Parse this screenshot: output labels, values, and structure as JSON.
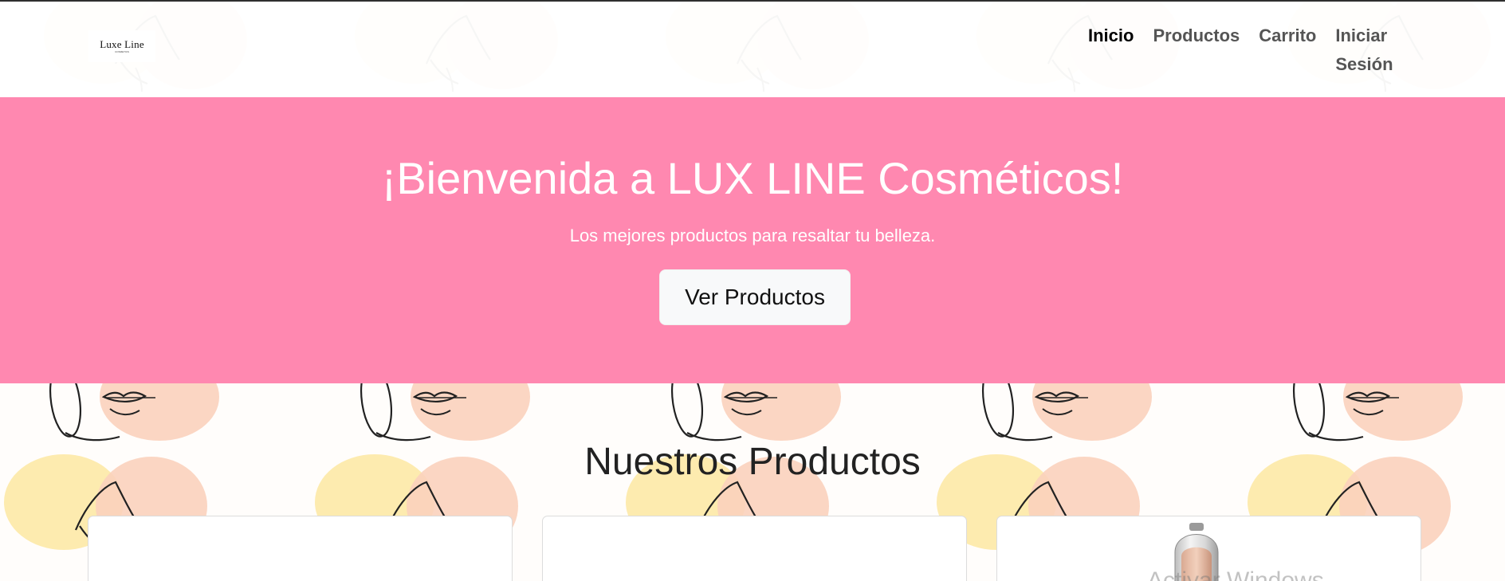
{
  "brand": {
    "name": "Luxe Line",
    "subtitle": "COSMETICS"
  },
  "nav": {
    "items": [
      {
        "label": "Inicio",
        "active": true
      },
      {
        "label": "Productos",
        "active": false
      },
      {
        "label": "Carrito",
        "active": false
      },
      {
        "label": "Iniciar Sesión",
        "active": false
      }
    ]
  },
  "hero": {
    "title": "¡Bienvenida a LUX LINE Cosméticos!",
    "subtitle": "Los mejores productos para resaltar tu belleza.",
    "button_label": "Ver Productos",
    "background_color": "#ff88b0"
  },
  "products": {
    "section_title": "Nuestros Productos"
  },
  "overlay": {
    "watermark_text": "Activar Windows"
  },
  "icons": {
    "background_pattern": "face-line-art-pattern",
    "product_image": "serum-bottle-icon"
  }
}
